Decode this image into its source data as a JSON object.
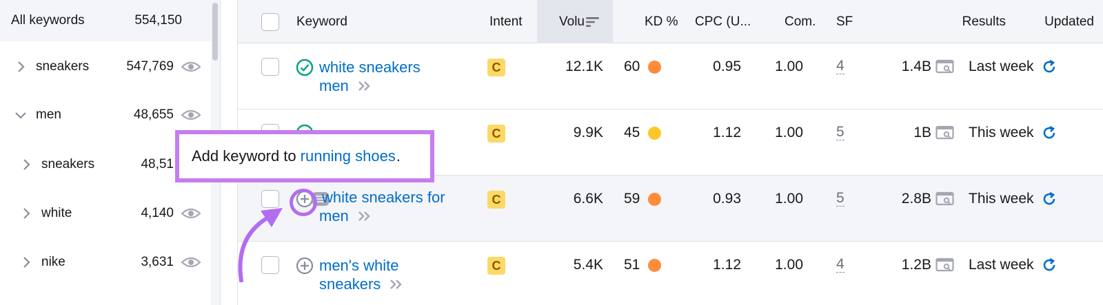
{
  "sidebar": {
    "header": {
      "label": "All keywords",
      "count": "554,150"
    },
    "items": [
      {
        "label": "sneakers",
        "count": "547,769",
        "expanded": false
      },
      {
        "label": "men",
        "count": "48,655",
        "expanded": true
      },
      {
        "label": "sneakers",
        "count": "48,51",
        "expanded": false
      },
      {
        "label": "white",
        "count": "4,140",
        "expanded": false
      },
      {
        "label": "nike",
        "count": "3,631",
        "expanded": false
      }
    ]
  },
  "table": {
    "columns": [
      "Keyword",
      "Intent",
      "Volu",
      "KD %",
      "CPC (U...",
      "Com.",
      "SF",
      "Results",
      "Updated"
    ],
    "rows": [
      {
        "kw_line1": "white sneakers",
        "kw_line2": "men",
        "intent": "C",
        "volume": "12.1K",
        "kd": "60",
        "kd_color": "#ff8c3b",
        "cpc": "0.95",
        "com": "1.00",
        "sf": "4",
        "results": "1.4B",
        "updated": "Last week",
        "status": "added"
      },
      {
        "kw_line1": "",
        "kw_line2": "",
        "intent": "C",
        "volume": "9.9K",
        "kd": "45",
        "kd_color": "#ffc62a",
        "cpc": "1.12",
        "com": "1.00",
        "sf": "5",
        "results": "1B",
        "updated": "This week",
        "status": "added"
      },
      {
        "kw_line1": "white sneakers for",
        "kw_line2": "men",
        "intent": "C",
        "volume": "6.6K",
        "kd": "59",
        "kd_color": "#ff8c3b",
        "cpc": "0.93",
        "com": "1.00",
        "sf": "5",
        "results": "2.8B",
        "updated": "This week",
        "status": "add"
      },
      {
        "kw_line1": "men's white",
        "kw_line2": "sneakers",
        "intent": "C",
        "volume": "5.4K",
        "kd": "51",
        "kd_color": "#ff8c3b",
        "cpc": "1.12",
        "com": "1.00",
        "sf": "4",
        "results": "1.2B",
        "updated": "Last week",
        "status": "add"
      }
    ]
  },
  "tooltip": {
    "prefix": "Add keyword to",
    "link": "running shoes",
    "suffix": "."
  },
  "colors": {
    "link": "#006dca",
    "accent": "#c57df0",
    "intent_badge": "#fcd966"
  },
  "icons": {
    "added": "check-circle-icon",
    "add": "plus-circle-icon",
    "results": "serp-preview-icon",
    "updated": "refresh-icon",
    "eye": "eye-icon",
    "sort": "sort-icon"
  }
}
